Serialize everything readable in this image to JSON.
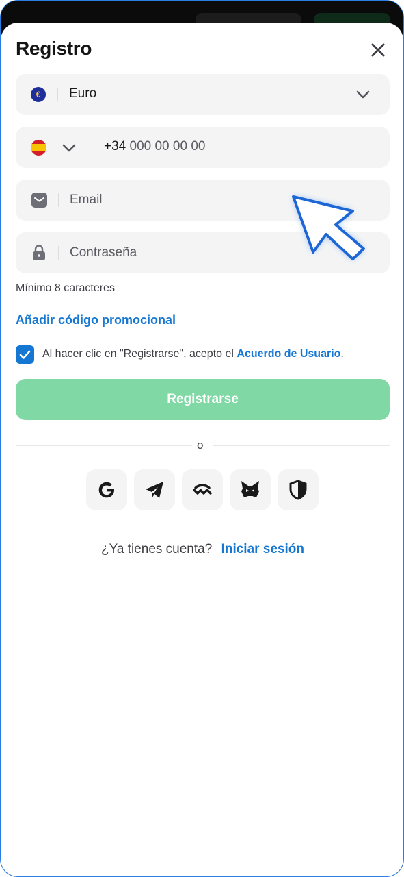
{
  "header": {
    "title": "Registro"
  },
  "currency": {
    "symbol": "€",
    "value": "Euro"
  },
  "phone": {
    "prefix": "+34",
    "placeholder": "000 00 00 00"
  },
  "email": {
    "placeholder": "Email"
  },
  "password": {
    "placeholder": "Contraseña",
    "hint": "Mínimo 8 caracteres"
  },
  "promo": {
    "label": "Añadir código promocional"
  },
  "agreement": {
    "checked": true,
    "text": "Al hacer clic en \"Registrarse\", acepto el",
    "link": "Acuerdo de Usuario",
    "suffix": "."
  },
  "register_button": {
    "label": "Registrarse"
  },
  "divider": {
    "label": "o"
  },
  "social": [
    "google-icon",
    "telegram-icon",
    "walletconnect-icon",
    "metamask-icon",
    "shield-icon"
  ],
  "login": {
    "prompt": "¿Ya tienes cuenta?",
    "link": "Iniciar sesión"
  },
  "colors": {
    "accent": "#1677d3",
    "register_button": "#80d8a5",
    "field_bg": "#f4f4f5",
    "frame_border": "#2a7de1"
  }
}
